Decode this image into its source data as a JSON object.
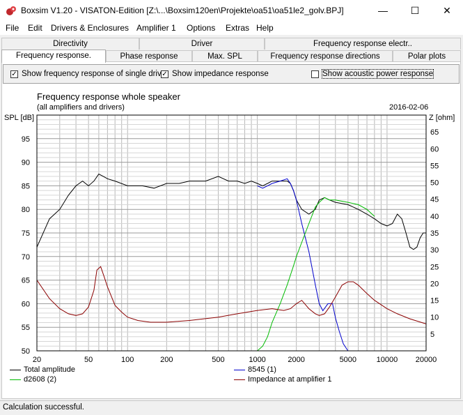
{
  "window": {
    "title": "Boxsim V1.20 - VISATON-Edition [Z:\\...\\Boxsim120en\\Projekte\\oa51\\oa51le2_golv.BPJ]",
    "minimize": "—",
    "maximize": "☐",
    "close": "✕"
  },
  "menu": [
    {
      "label": "File"
    },
    {
      "label": "Edit"
    },
    {
      "label": "Drivers & Enclosures"
    },
    {
      "label": "Amplifier 1"
    },
    {
      "label": "Options"
    },
    {
      "label": "Extras"
    },
    {
      "label": "Help"
    }
  ],
  "tabs_top": [
    {
      "label": "Directivity"
    },
    {
      "label": "Driver"
    },
    {
      "label": "Frequency response electr.."
    }
  ],
  "tabs_bottom": [
    {
      "label": "Frequency response."
    },
    {
      "label": "Phase response"
    },
    {
      "label": "Max. SPL"
    },
    {
      "label": "Frequency response directions"
    },
    {
      "label": "Polar plots"
    }
  ],
  "options": {
    "single_drive": {
      "label": "Show frequency response of single drive",
      "checked": true
    },
    "impedance": {
      "label": "Show impedance response",
      "checked": true
    },
    "acoustic_power": {
      "label": "Show acoustic power response",
      "checked": false
    }
  },
  "chart": {
    "title": "Frequency response whole speaker",
    "subtitle": "(all amplifiers and drivers)",
    "date": "2016-02-06",
    "left_axis_title": "SPL [dB]",
    "right_axis_title": "Z [ohm]"
  },
  "chart_data": {
    "type": "line",
    "x_scale": "log",
    "xlim": [
      20,
      20000
    ],
    "ylim": [
      50,
      100
    ],
    "y2lim": [
      0,
      70
    ],
    "x_ticks": [
      "20",
      "50",
      "100",
      "200",
      "500",
      "1000",
      "2000",
      "5000",
      "10000",
      "20000"
    ],
    "y_ticks": [
      "50",
      "55",
      "60",
      "65",
      "70",
      "75",
      "80",
      "85",
      "90",
      "95"
    ],
    "y2_ticks": [
      "5",
      "10",
      "15",
      "20",
      "25",
      "30",
      "35",
      "40",
      "45",
      "50",
      "55",
      "60",
      "65"
    ],
    "grid": true,
    "series": [
      {
        "name": "Total amplitude",
        "axis": "left",
        "color": "#000000",
        "x": [
          20,
          25,
          30,
          35,
          40,
          45,
          50,
          55,
          60,
          65,
          70,
          80,
          100,
          130,
          160,
          200,
          250,
          300,
          400,
          500,
          600,
          700,
          800,
          900,
          1000,
          1100,
          1200,
          1300,
          1500,
          1700,
          1800,
          1900,
          2000,
          2200,
          2500,
          2800,
          3000,
          3300,
          3600,
          4000,
          5000,
          6000,
          7000,
          8000,
          9000,
          10000,
          11000,
          12000,
          13000,
          14000,
          15000,
          16000,
          17000,
          18000,
          19000,
          20000
        ],
        "y": [
          72,
          78,
          80,
          83,
          85,
          86,
          85,
          86,
          87.5,
          87,
          86.5,
          86,
          85,
          85,
          84.5,
          85.5,
          85.5,
          86,
          86,
          87,
          86,
          86,
          85.5,
          86,
          85.5,
          85,
          85.5,
          86,
          86,
          86,
          85.5,
          84,
          82,
          80,
          79,
          80,
          82,
          82.5,
          82,
          81.5,
          81,
          80,
          79,
          78,
          77,
          76.5,
          77,
          79,
          78,
          75,
          72,
          71.5,
          72,
          74,
          75,
          75
        ]
      },
      {
        "name": "8545 (1)",
        "axis": "left",
        "color": "#0000cc",
        "x": [
          1000,
          1100,
          1200,
          1300,
          1500,
          1700,
          1800,
          1900,
          2000,
          2200,
          2500,
          2800,
          3000,
          3200,
          3500,
          3800,
          4000,
          4300,
          4600,
          5000
        ],
        "y": [
          85,
          84.5,
          85,
          85.5,
          86,
          86.5,
          85.5,
          84,
          82,
          77,
          71,
          64,
          60,
          58.5,
          60,
          60,
          57,
          54,
          51.5,
          50
        ]
      },
      {
        "name": "d2608  (2)",
        "axis": "left",
        "color": "#00bb00",
        "x": [
          20,
          500,
          1000,
          1100,
          1200,
          1300,
          1500,
          1700,
          1900,
          2000,
          2200,
          2500,
          2800,
          3000,
          3300,
          3600,
          4000,
          5000,
          6000,
          7000,
          8000
        ],
        "y": [
          50,
          50,
          50,
          51,
          53,
          56,
          60,
          64,
          68,
          70,
          73,
          77,
          80.5,
          81.5,
          82.5,
          82,
          82,
          81.5,
          81,
          80,
          78.5
        ]
      },
      {
        "name": "Impedance at amplifier 1",
        "axis": "right",
        "color": "#8b0000",
        "x": [
          20,
          25,
          30,
          35,
          40,
          45,
          50,
          55,
          58,
          62,
          66,
          70,
          80,
          90,
          100,
          120,
          150,
          200,
          300,
          500,
          700,
          1000,
          1300,
          1600,
          1800,
          2000,
          2200,
          2500,
          2800,
          3000,
          3300,
          3600,
          4000,
          4500,
          5000,
          5500,
          6000,
          7000,
          8000,
          10000,
          12000,
          15000,
          20000
        ],
        "y": [
          21,
          15.5,
          12.5,
          11,
          10.5,
          11,
          13,
          18,
          24,
          25,
          22,
          19,
          13.5,
          11.5,
          10,
          9,
          8.5,
          8.5,
          9,
          10,
          11,
          12,
          12.5,
          12,
          12.5,
          14,
          15,
          12.5,
          11,
          10.5,
          11,
          13,
          16,
          19.5,
          20.5,
          20.5,
          19.5,
          17,
          15,
          12.5,
          11,
          9.5,
          8
        ]
      }
    ]
  },
  "status": "Calculation successful."
}
